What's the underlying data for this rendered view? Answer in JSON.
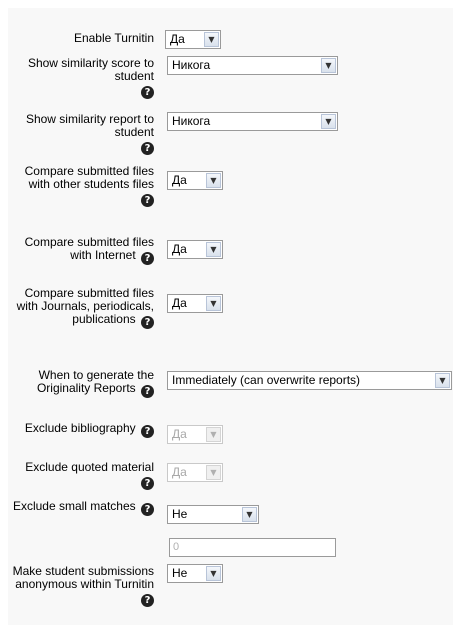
{
  "fields": {
    "enable_turnitin": {
      "label": "Enable Turnitin",
      "value": "Да"
    },
    "show_score": {
      "label": "Show similarity score to student",
      "value": "Никога"
    },
    "show_report": {
      "label": "Show similarity report to student",
      "value": "Никога"
    },
    "compare_students": {
      "label": "Compare submitted files with other students files",
      "value": "Да"
    },
    "compare_internet": {
      "label": "Compare submitted files with Internet",
      "value": "Да"
    },
    "compare_journals": {
      "label": "Compare submitted files with Journals, periodicals, publications",
      "value": "Да"
    },
    "generate_reports": {
      "label": "When to generate the Originality Reports",
      "value": "Immediately (can overwrite reports)"
    },
    "exclude_bibliography": {
      "label": "Exclude bibliography",
      "value": "Да"
    },
    "exclude_quoted": {
      "label": "Exclude quoted material",
      "value": "Да"
    },
    "exclude_small": {
      "label": "Exclude small matches",
      "value": "Не",
      "size_value": "0"
    },
    "anonymous": {
      "label": "Make student submissions anonymous within Turnitin",
      "value": "Не"
    }
  },
  "icons": {
    "help": "help-icon",
    "dropdown": "chevron-down-icon"
  },
  "glyphs": {
    "help": "?",
    "arrow": "▼"
  }
}
